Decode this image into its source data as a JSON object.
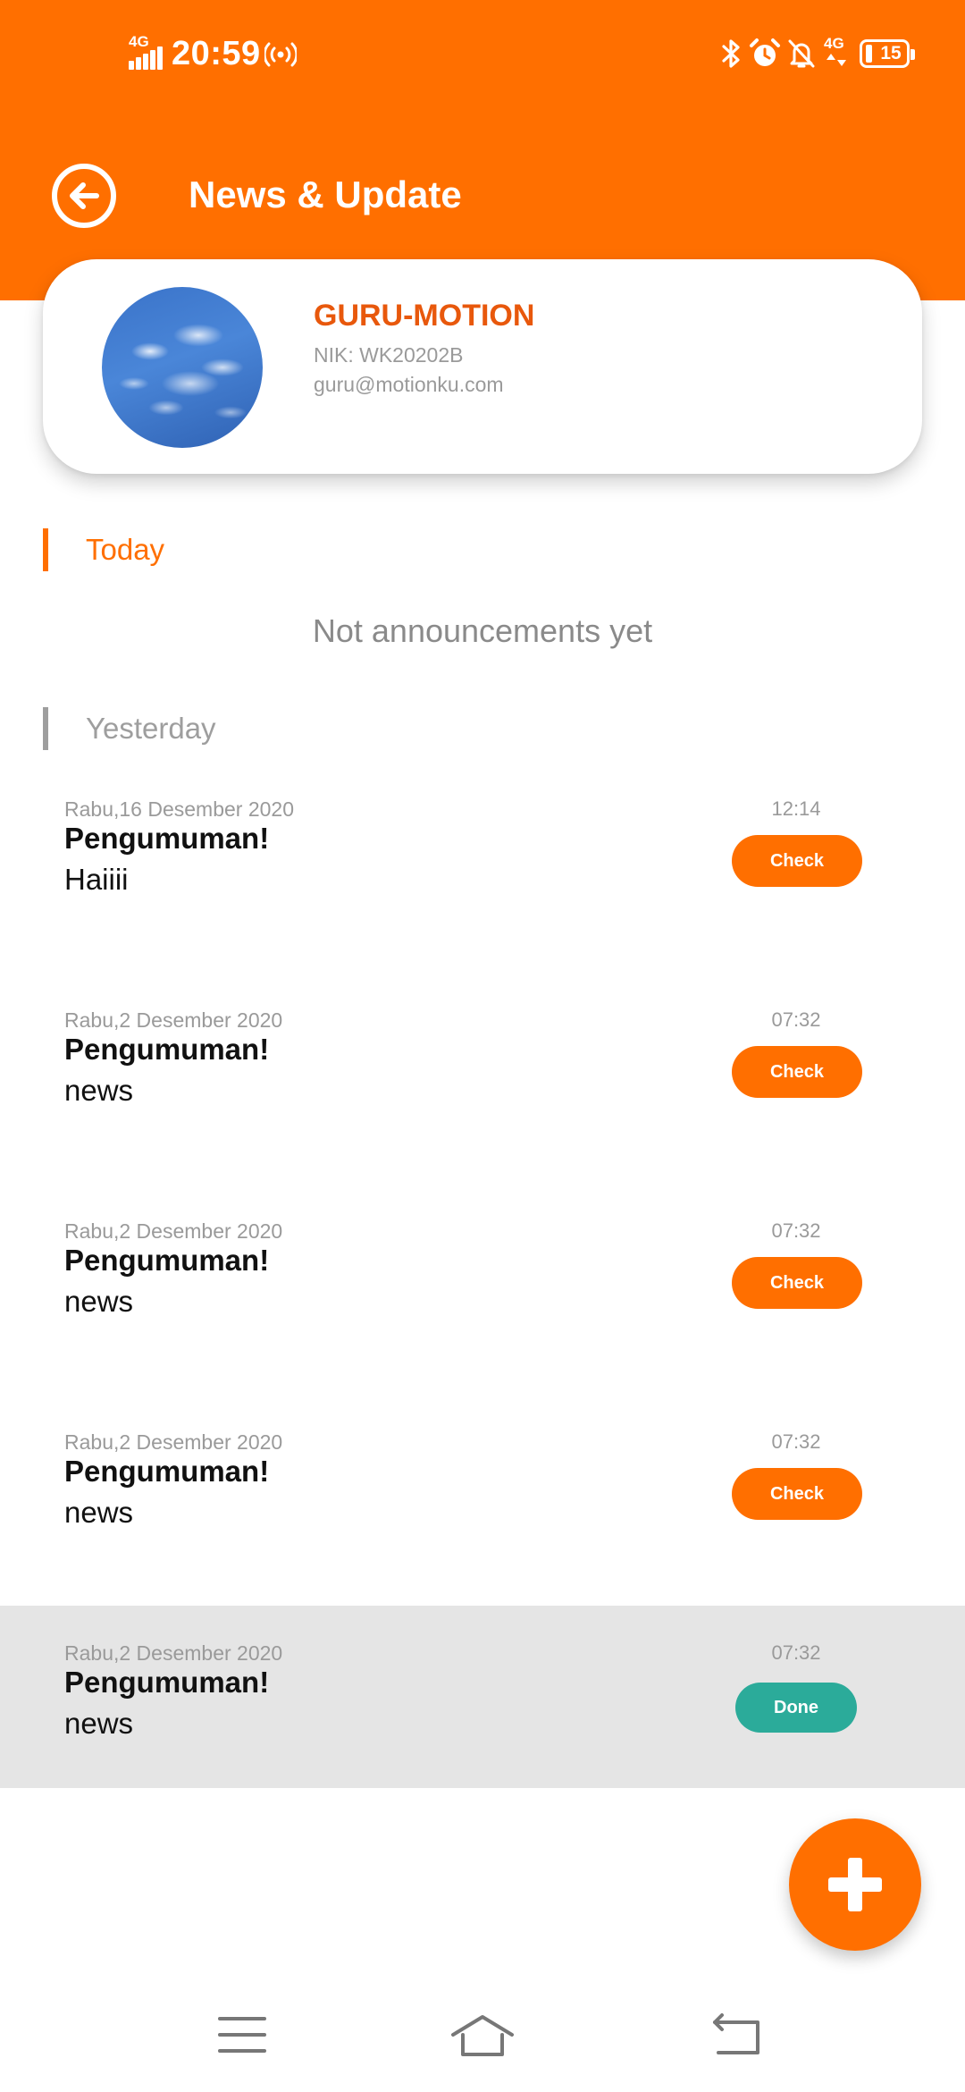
{
  "status_bar": {
    "network_tag": "4G",
    "time": "20:59",
    "network_tag_right": "4G",
    "battery_level": "15",
    "icons": [
      "signal-icon",
      "hotspot-icon",
      "bluetooth-icon",
      "alarm-icon",
      "bell-off-icon",
      "mobile-data-icon",
      "battery-icon"
    ]
  },
  "header": {
    "title": "News & Update",
    "back_icon": "arrow-left-circle-icon",
    "background_color": "#FF6F00"
  },
  "profile": {
    "name": "GURU-MOTION",
    "nik": "NIK: WK20202B",
    "email": "guru@motionku.com",
    "name_color": "#E8580C"
  },
  "sections": {
    "today_label": "Today",
    "today_empty": "Not announcements yet",
    "yesterday_label": "Yesterday",
    "today_color": "#FF6F00",
    "yesterday_color": "#9E9E9E"
  },
  "news": [
    {
      "date": "Rabu,16 Desember 2020",
      "title": "Pengumuman!",
      "body": "Haiiii",
      "time": "12:14",
      "action": "Check",
      "status": "pending"
    },
    {
      "date": "Rabu,2 Desember 2020",
      "title": "Pengumuman!",
      "body": "news",
      "time": "07:32",
      "action": "Check",
      "status": "pending"
    },
    {
      "date": "Rabu,2 Desember 2020",
      "title": "Pengumuman!",
      "body": "news",
      "time": "07:32",
      "action": "Check",
      "status": "pending"
    },
    {
      "date": "Rabu,2 Desember 2020",
      "title": "Pengumuman!",
      "body": "news",
      "time": "07:32",
      "action": "Check",
      "status": "pending"
    },
    {
      "date": "Rabu,2 Desember 2020",
      "title": "Pengumuman!",
      "body": "news",
      "time": "07:32",
      "action": "Done",
      "status": "done"
    }
  ],
  "colors": {
    "accent": "#FF6F00",
    "done": "#2BAB9A"
  },
  "fab": {
    "icon": "plus-icon"
  },
  "nav_bar": {
    "icons": [
      "menu-icon",
      "home-icon",
      "back-icon"
    ]
  }
}
